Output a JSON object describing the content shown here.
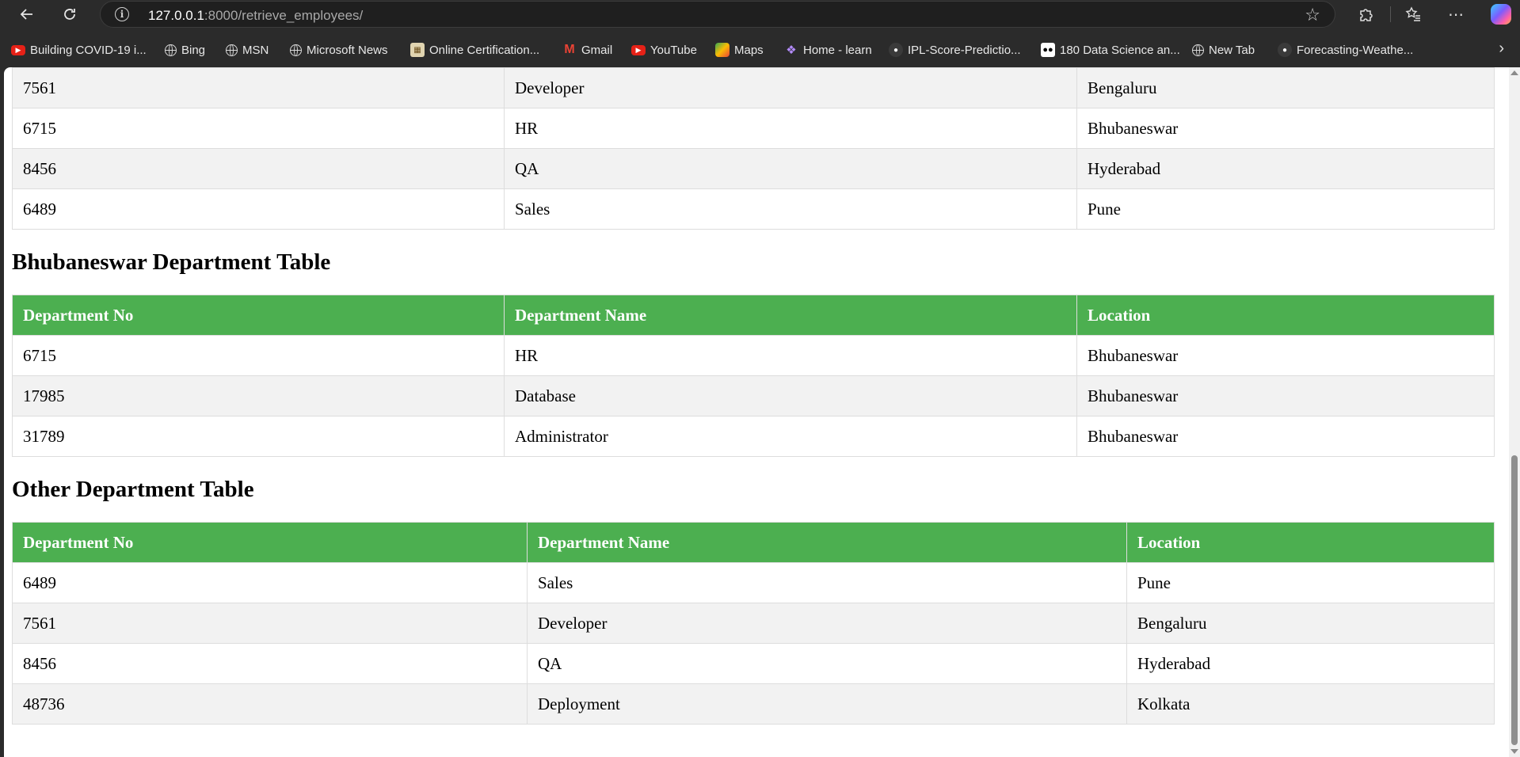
{
  "browser": {
    "url_host": "127.0.0.1",
    "url_path": ":8000/retrieve_employees/",
    "bookmarks": [
      {
        "label": "Building COVID-19 i...",
        "icon": "youtube-icon"
      },
      {
        "label": "Bing",
        "icon": "globe-icon"
      },
      {
        "label": "MSN",
        "icon": "globe-icon"
      },
      {
        "label": "Microsoft News",
        "icon": "globe-icon"
      },
      {
        "label": "Online Certification...",
        "icon": "certificate-icon"
      },
      {
        "label": "Gmail",
        "icon": "gmail-icon"
      },
      {
        "label": "YouTube",
        "icon": "youtube-icon"
      },
      {
        "label": "Maps",
        "icon": "maps-icon"
      },
      {
        "label": "Home - learn",
        "icon": "learn-icon"
      },
      {
        "label": "IPL-Score-Predictio...",
        "icon": "github-icon"
      },
      {
        "label": "180 Data Science an...",
        "icon": "medium-icon"
      },
      {
        "label": "New Tab",
        "icon": "globe-icon"
      },
      {
        "label": "Forecasting-Weathe...",
        "icon": "github-icon"
      }
    ]
  },
  "top_table": {
    "rows": [
      [
        "7561",
        "Developer",
        "Bengaluru"
      ],
      [
        "6715",
        "HR",
        "Bhubaneswar"
      ],
      [
        "8456",
        "QA",
        "Hyderabad"
      ],
      [
        "6489",
        "Sales",
        "Pune"
      ]
    ]
  },
  "bhubaneswar": {
    "title": "Bhubaneswar Department Table",
    "headers": [
      "Department No",
      "Department Name",
      "Location"
    ],
    "rows": [
      [
        "6715",
        "HR",
        "Bhubaneswar"
      ],
      [
        "17985",
        "Database",
        "Bhubaneswar"
      ],
      [
        "31789",
        "Administrator",
        "Bhubaneswar"
      ]
    ]
  },
  "other": {
    "title": "Other Department Table",
    "headers": [
      "Department No",
      "Department Name",
      "Location"
    ],
    "rows": [
      [
        "6489",
        "Sales",
        "Pune"
      ],
      [
        "7561",
        "Developer",
        "Bengaluru"
      ],
      [
        "8456",
        "QA",
        "Hyderabad"
      ],
      [
        "48736",
        "Deployment",
        "Kolkata"
      ]
    ]
  },
  "colors": {
    "header_green": "#4caf50",
    "row_stripe": "#f2f2f2"
  }
}
